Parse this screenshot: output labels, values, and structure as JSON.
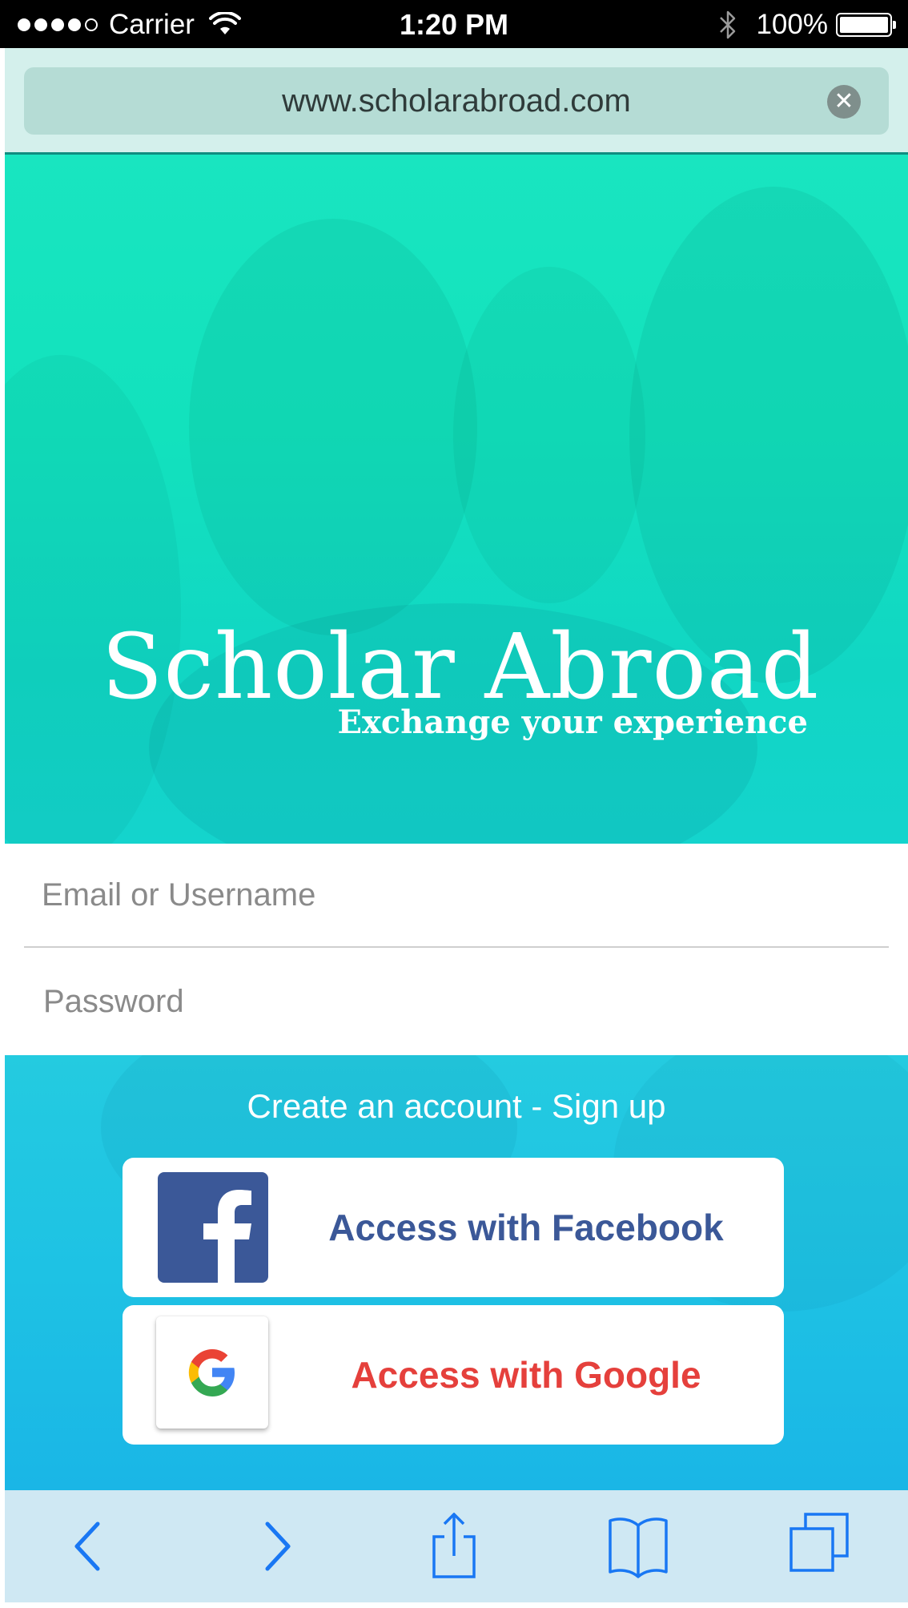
{
  "status_bar": {
    "carrier": "Carrier",
    "time": "1:20 PM",
    "battery": "100%",
    "signal_icon": "signal-dots-icon",
    "wifi_icon": "wifi-icon",
    "bluetooth_icon": "bluetooth-icon",
    "battery_icon": "battery-icon"
  },
  "browser": {
    "url": "www.scholarabroad.com",
    "clear_icon": "clear-x-icon"
  },
  "hero": {
    "title": "Scholar Abroad",
    "subtitle": "Exchange your experience",
    "colors": {
      "top": "#19e5c0",
      "bottom": "#14d4cd"
    }
  },
  "login": {
    "email_placeholder": "Email or Username",
    "password_placeholder": "Password"
  },
  "signup": {
    "link": "Create an account - Sign up",
    "facebook_label": "Access with Facebook",
    "google_label": "Access with Google",
    "facebook_color": "#3b5898",
    "google_color": "#e5403c"
  },
  "toolbar": {
    "items": [
      "back-icon",
      "forward-icon",
      "share-icon",
      "bookmarks-icon",
      "tabs-icon"
    ],
    "accent": "#1977f3"
  }
}
